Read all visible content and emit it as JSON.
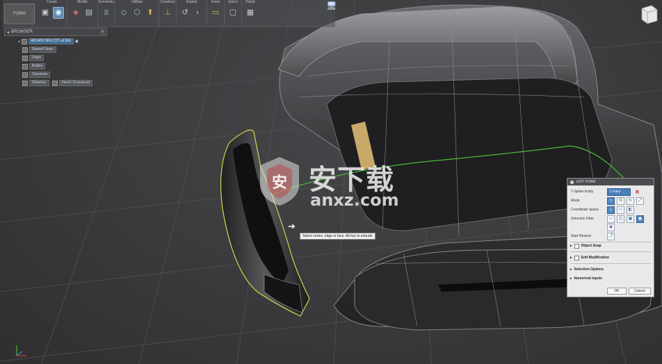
{
  "toolbar": {
    "workspace": "FORM",
    "groups": [
      {
        "label": "Create",
        "icons": [
          "box-icon",
          "cylinder-icon"
        ]
      },
      {
        "label": "Modify",
        "icons": [
          "edit-form-icon",
          "insert-edge-icon"
        ]
      },
      {
        "label": "Symmetry",
        "icons": [
          "symmetry-icon"
        ]
      },
      {
        "label": "Utilities",
        "icons": [
          "repair-icon",
          "convert-icon",
          "pull-icon"
        ]
      },
      {
        "label": "Construct",
        "icons": [
          "plane-icon"
        ]
      },
      {
        "label": "Inspect",
        "icons": [
          "measure-icon",
          "zebra-icon"
        ]
      },
      {
        "label": "Insert",
        "icons": [
          "insert-icon"
        ]
      },
      {
        "label": "Select",
        "icons": [
          "select-icon"
        ]
      },
      {
        "label": "Finish",
        "icons": [
          "finish-form-icon"
        ]
      }
    ]
  },
  "browser": {
    "title": "BROWSER",
    "root": "AH1400 OHS C2T ull 500",
    "items": [
      "Named Views",
      "Origin",
      "Bodies",
      "Canvases",
      "Sketches",
      "Form1 (Construct)"
    ]
  },
  "tooltip": "Select vertex, edge or face. Alt key to extrude",
  "watermark": {
    "cn": "安下载",
    "en": "anxz.com"
  },
  "edit_form": {
    "title": "EDIT FORM",
    "rows": {
      "tspline_entity": "T-Spline Entity",
      "mode": "Mode",
      "coordinate_space": "Coordinate Space",
      "selection_filter": "Selection Filter",
      "start_restore": "Start Restore"
    },
    "entity_value": "1 Face",
    "sections": {
      "object_snap": "Object Snap",
      "soft_modification": "Soft Modification",
      "selection_options": "Selection Options",
      "numerical_inputs": "Numerical Inputs"
    },
    "ok": "OK",
    "cancel": "Cancel"
  },
  "colors": {
    "accent_blue": "#4a7fb9",
    "curve_green": "#4dbb3a",
    "edge_yellow": "#d8d44a",
    "face_highlight": "#c9a86a"
  }
}
